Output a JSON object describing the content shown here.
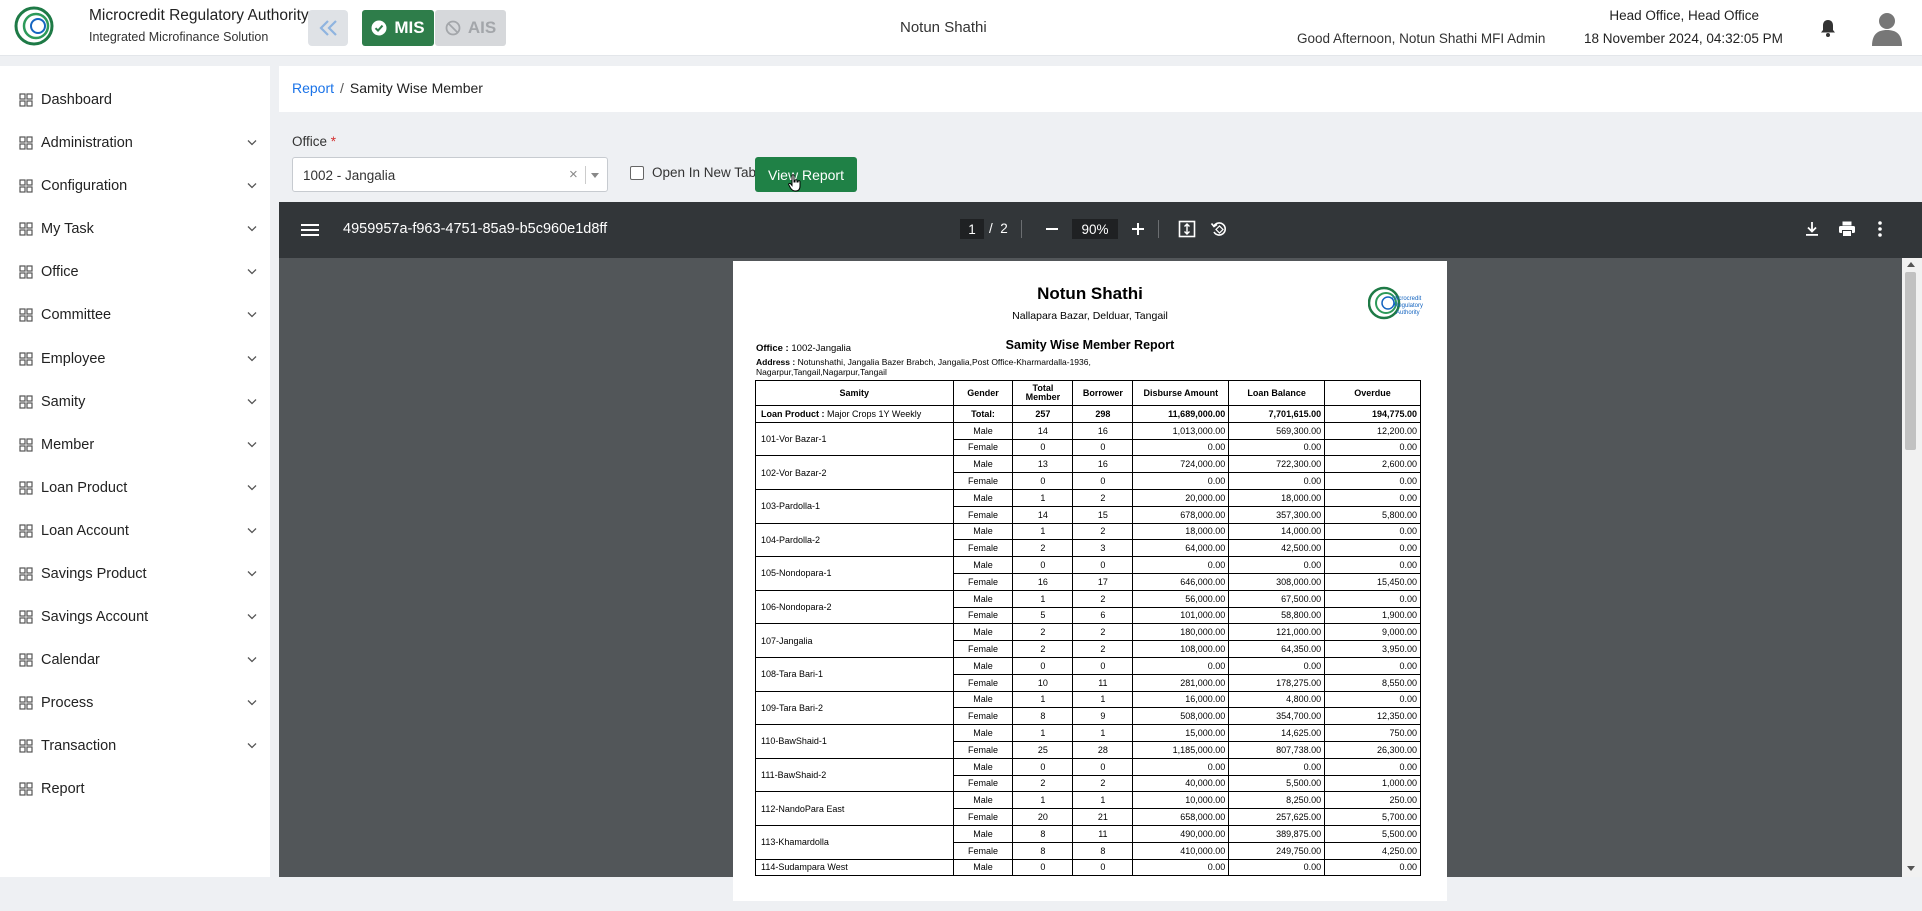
{
  "header": {
    "brand_title": "Microcredit Regulatory Authority",
    "brand_subtitle": "Integrated Microfinance Solution",
    "logo_text": "Microcredit Regulatory Authority",
    "mis_label": "MIS",
    "ais_label": "AIS",
    "org_name": "Notun Shathi",
    "greeting": "Good Afternoon, Notun Shathi MFI Admin",
    "office": "Head Office, Head Office",
    "datetime": "18 November 2024, 04:32:05 PM"
  },
  "sidebar": {
    "items": [
      {
        "label": "Dashboard",
        "icon": "grid-icon",
        "expandable": false
      },
      {
        "label": "Administration",
        "icon": "admin-icon",
        "expandable": true
      },
      {
        "label": "Configuration",
        "icon": "sliders-icon",
        "expandable": true
      },
      {
        "label": "My Task",
        "icon": "task-icon",
        "expandable": true
      },
      {
        "label": "Office",
        "icon": "building-icon",
        "expandable": true
      },
      {
        "label": "Committee",
        "icon": "committee-icon",
        "expandable": true
      },
      {
        "label": "Employee",
        "icon": "employee-icon",
        "expandable": true
      },
      {
        "label": "Samity",
        "icon": "samity-icon",
        "expandable": true
      },
      {
        "label": "Member",
        "icon": "member-icon",
        "expandable": true
      },
      {
        "label": "Loan Product",
        "icon": "loan-product-icon",
        "expandable": true
      },
      {
        "label": "Loan Account",
        "icon": "loan-account-icon",
        "expandable": true
      },
      {
        "label": "Savings Product",
        "icon": "savings-product-icon",
        "expandable": true
      },
      {
        "label": "Savings Account",
        "icon": "savings-account-icon",
        "expandable": true
      },
      {
        "label": "Calendar",
        "icon": "calendar-icon",
        "expandable": true
      },
      {
        "label": "Process",
        "icon": "process-icon",
        "expandable": true
      },
      {
        "label": "Transaction",
        "icon": "transaction-icon",
        "expandable": true
      },
      {
        "label": "Report",
        "icon": "report-icon",
        "expandable": false
      }
    ]
  },
  "breadcrumb": {
    "root": "Report",
    "separator": "/",
    "current": "Samity Wise Member"
  },
  "form": {
    "office_label": "Office",
    "required_mark": "*",
    "office_value": "1002 - Jangalia",
    "clear_symbol": "×",
    "open_new_tab_label": "Open In New Tab",
    "view_report_label": "View Report"
  },
  "pdf": {
    "filename": "4959957a-f963-4751-85a9-b5c960e1d8ff",
    "current_page": "1",
    "page_sep": "/",
    "total_pages": "2",
    "zoom": "90%"
  },
  "report": {
    "org_name": "Notun Shathi",
    "org_address": "Nallapara Bazar, Delduar, Tangail",
    "title": "Samity Wise Member Report",
    "office_label": "Office :",
    "office_value": "1002-Jangalia",
    "address_label": "Address :",
    "address_value": "Notunshathi, Jangalia Bazer Brabch, Jangalia,Post Office-Kharmardalla-1936, Nagarpur,Tangail,Nagarpur,Tangail",
    "logo_text": "Microcredit Regulatory Authority",
    "headers": [
      "Samity",
      "Gender",
      "Total Member",
      "Borrower",
      "Disburse Amount",
      "Loan Balance",
      "Overdue"
    ],
    "total_row": {
      "product_label": "Loan Product :",
      "product": "Major Crops 1Y Weekly",
      "label": "Total:",
      "total_member": "257",
      "borrower": "298",
      "disburse": "11,689,000.00",
      "balance": "7,701,615.00",
      "overdue": "194,775.00"
    },
    "rows": [
      {
        "samity": "101-Vor Bazar-1",
        "male": [
          "14",
          "16",
          "1,013,000.00",
          "569,300.00",
          "12,200.00"
        ],
        "female": [
          "0",
          "0",
          "0.00",
          "0.00",
          "0.00"
        ]
      },
      {
        "samity": "102-Vor Bazar-2",
        "male": [
          "13",
          "16",
          "724,000.00",
          "722,300.00",
          "2,600.00"
        ],
        "female": [
          "0",
          "0",
          "0.00",
          "0.00",
          "0.00"
        ]
      },
      {
        "samity": "103-Pardolla-1",
        "male": [
          "1",
          "2",
          "20,000.00",
          "18,000.00",
          "0.00"
        ],
        "female": [
          "14",
          "15",
          "678,000.00",
          "357,300.00",
          "5,800.00"
        ]
      },
      {
        "samity": "104-Pardolla-2",
        "male": [
          "1",
          "2",
          "18,000.00",
          "14,000.00",
          "0.00"
        ],
        "female": [
          "2",
          "3",
          "64,000.00",
          "42,500.00",
          "0.00"
        ]
      },
      {
        "samity": "105-Nondopara-1",
        "male": [
          "0",
          "0",
          "0.00",
          "0.00",
          "0.00"
        ],
        "female": [
          "16",
          "17",
          "646,000.00",
          "308,000.00",
          "15,450.00"
        ]
      },
      {
        "samity": "106-Nondopara-2",
        "male": [
          "1",
          "2",
          "56,000.00",
          "67,500.00",
          "0.00"
        ],
        "female": [
          "5",
          "6",
          "101,000.00",
          "58,800.00",
          "1,900.00"
        ]
      },
      {
        "samity": "107-Jangalia",
        "male": [
          "2",
          "2",
          "180,000.00",
          "121,000.00",
          "9,000.00"
        ],
        "female": [
          "2",
          "2",
          "108,000.00",
          "64,350.00",
          "3,950.00"
        ]
      },
      {
        "samity": "108-Tara Bari-1",
        "male": [
          "0",
          "0",
          "0.00",
          "0.00",
          "0.00"
        ],
        "female": [
          "10",
          "11",
          "281,000.00",
          "178,275.00",
          "8,550.00"
        ]
      },
      {
        "samity": "109-Tara Bari-2",
        "male": [
          "1",
          "1",
          "16,000.00",
          "4,800.00",
          "0.00"
        ],
        "female": [
          "8",
          "9",
          "508,000.00",
          "354,700.00",
          "12,350.00"
        ]
      },
      {
        "samity": "110-BawShaid-1",
        "male": [
          "1",
          "1",
          "15,000.00",
          "14,625.00",
          "750.00"
        ],
        "female": [
          "25",
          "28",
          "1,185,000.00",
          "807,738.00",
          "26,300.00"
        ]
      },
      {
        "samity": "111-BawShaid-2",
        "male": [
          "0",
          "0",
          "0.00",
          "0.00",
          "0.00"
        ],
        "female": [
          "2",
          "2",
          "40,000.00",
          "5,500.00",
          "1,000.00"
        ]
      },
      {
        "samity": "112-NandoPara East",
        "male": [
          "1",
          "1",
          "10,000.00",
          "8,250.00",
          "250.00"
        ],
        "female": [
          "20",
          "21",
          "658,000.00",
          "257,625.00",
          "5,700.00"
        ]
      },
      {
        "samity": "113-Khamardolla",
        "male": [
          "8",
          "11",
          "490,000.00",
          "389,875.00",
          "5,500.00"
        ],
        "female": [
          "8",
          "8",
          "410,000.00",
          "249,750.00",
          "4,250.00"
        ]
      },
      {
        "samity": "114-Sudampara West",
        "male": [
          "0",
          "0",
          "0.00",
          "0.00",
          "0.00"
        ],
        "female": null
      }
    ],
    "gender_male": "Male",
    "gender_female": "Female"
  }
}
